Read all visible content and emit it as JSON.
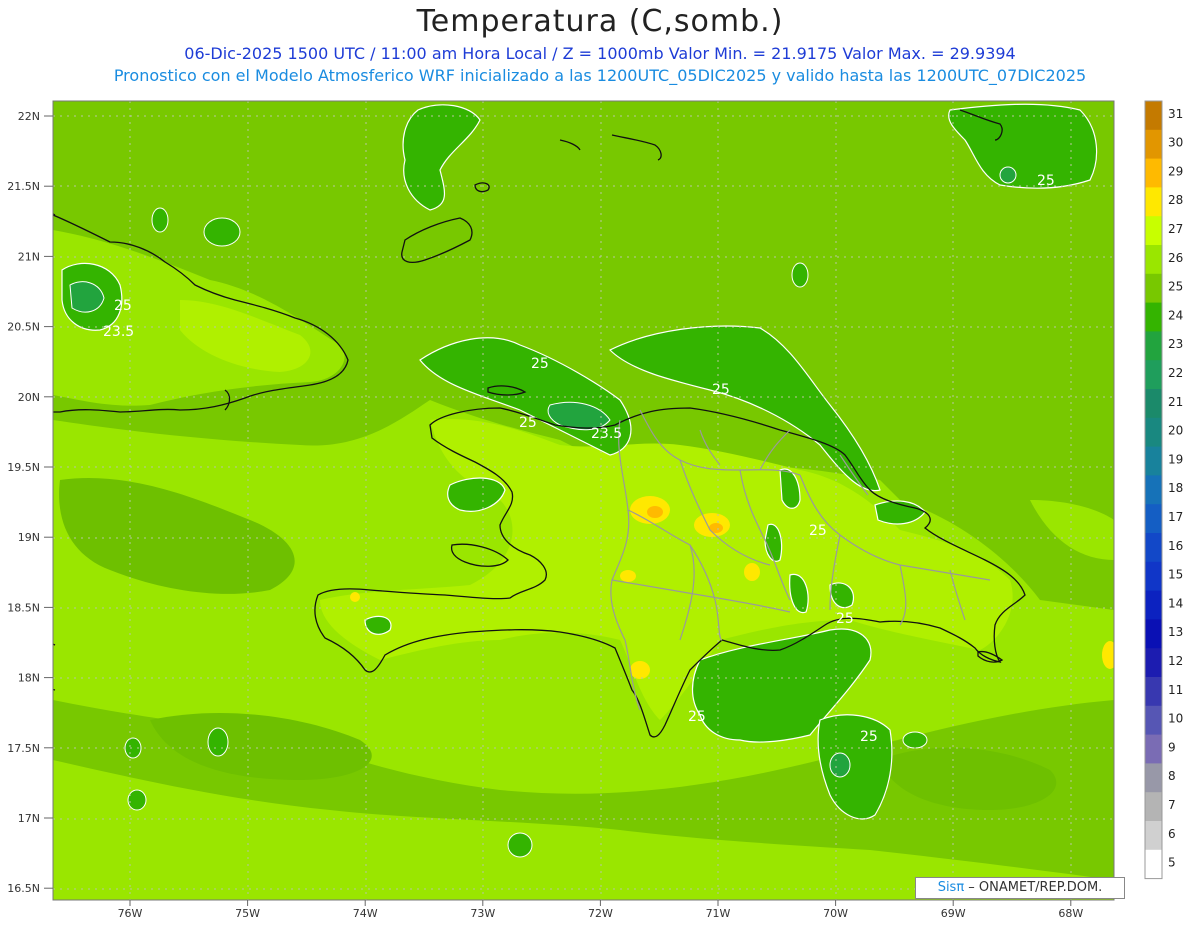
{
  "header": {
    "title": "Temperatura (C,somb.)",
    "subtitle_1": "06-Dic-2025 1500 UTC / 11:00 am Hora Local / Z = 1000mb   Valor Min. = 21.9175  Valor Max. = 29.9394",
    "subtitle_2": "Pronostico con el Modelo Atmosferico WRF inicializado a las 1200UTC_05DIC2025 y valido hasta las  1200UTC_07DIC2025"
  },
  "axes": {
    "lat_labels": [
      "22N",
      "21.5N",
      "21N",
      "20.5N",
      "20N",
      "19.5N",
      "19N",
      "18.5N",
      "18N",
      "17.5N",
      "17N",
      "16.5N"
    ],
    "lon_labels": [
      "76W",
      "75W",
      "74W",
      "73W",
      "72W",
      "71W",
      "70W",
      "69W",
      "68W"
    ]
  },
  "colorbar": {
    "labels": [
      "31",
      "30",
      "29",
      "28",
      "27",
      "26",
      "25",
      "24",
      "23",
      "22",
      "21",
      "20",
      "19",
      "18",
      "17",
      "16",
      "15",
      "14",
      "13",
      "12",
      "11",
      "10",
      "9",
      "8",
      "7",
      "6",
      "5"
    ],
    "colors": [
      "#c47a00",
      "#e29600",
      "#ffba00",
      "#ffe800",
      "#c8ff00",
      "#9ae600",
      "#78c800",
      "#34b400",
      "#22a43e",
      "#1f9e5c",
      "#1b8a6a",
      "#198880",
      "#18829c",
      "#1672b8",
      "#145ec4",
      "#1248c8",
      "#1036c8",
      "#0c22c0",
      "#0a10b4",
      "#1c1cb0",
      "#3838b0",
      "#5656b4",
      "#7a6cb4",
      "#9898a8",
      "#b4b4b4",
      "#d0d0d0",
      "#ffffff"
    ]
  },
  "contours": {
    "labels": [
      "25",
      "25",
      "25",
      "25",
      "25",
      "25",
      "25",
      "25",
      "25",
      "23.5",
      "23.5"
    ]
  },
  "credit": {
    "brand": "Sisπ",
    "org": " – ONAMET/REP.DOM."
  }
}
